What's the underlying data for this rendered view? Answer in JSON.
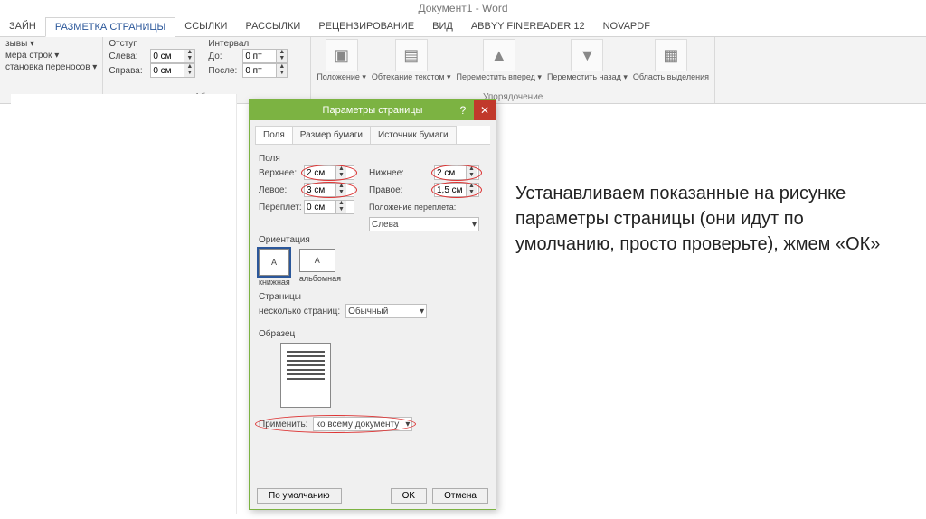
{
  "window_title": "Документ1 - Word",
  "tabs": [
    "ЗАЙН",
    "РАЗМЕТКА СТРАНИЦЫ",
    "ССЫЛКИ",
    "РАССЫЛКИ",
    "РЕЦЕНЗИРОВАНИЕ",
    "ВИД",
    "ABBYY FineReader 12",
    "novaPDF"
  ],
  "ribbon": {
    "page_setup": {
      "items": [
        "зывы ▾",
        "мера строк ▾",
        "становка переносов ▾"
      ]
    },
    "indent": {
      "label": "Отступ",
      "left_label": "Слева:",
      "left_value": "0 см",
      "right_label": "Справа:",
      "right_value": "0 см"
    },
    "spacing": {
      "label": "Интервал",
      "before_label": "До:",
      "before_value": "0 пт",
      "after_label": "После:",
      "after_value": "0 пт"
    },
    "paragraph_label": "Абзац",
    "arrange": {
      "label": "Упорядочение",
      "items": [
        "Положение ▾",
        "Обтекание текстом ▾",
        "Переместить вперед ▾",
        "Переместить назад ▾",
        "Область выделения"
      ]
    }
  },
  "dialog": {
    "title": "Параметры страницы",
    "tabs": [
      "Поля",
      "Размер бумаги",
      "Источник бумаги"
    ],
    "fields_label": "Поля",
    "top_label": "Верхнее:",
    "top_value": "2 см",
    "bottom_label": "Нижнее:",
    "bottom_value": "2 см",
    "left_label": "Левое:",
    "left_value": "3 см",
    "right_label": "Правое:",
    "right_value": "1,5 см",
    "gutter_label": "Переплет:",
    "gutter_value": "0 см",
    "gutter_pos_label": "Положение переплета:",
    "gutter_pos_value": "Слева",
    "orient_label": "Ориентация",
    "orient_portrait": "книжная",
    "orient_landscape": "альбомная",
    "pages_label": "Страницы",
    "multipages_label": "несколько страниц:",
    "multipages_value": "Обычный",
    "preview_label": "Образец",
    "apply_label": "Применить:",
    "apply_value": "ко всему документу",
    "default_btn": "По умолчанию",
    "ok_btn": "OK",
    "cancel_btn": "Отмена"
  },
  "annotation": "Устанавливаем показанные на рисунке параметры страницы (они идут по умолчанию, просто проверьте), жмем «ОК»"
}
